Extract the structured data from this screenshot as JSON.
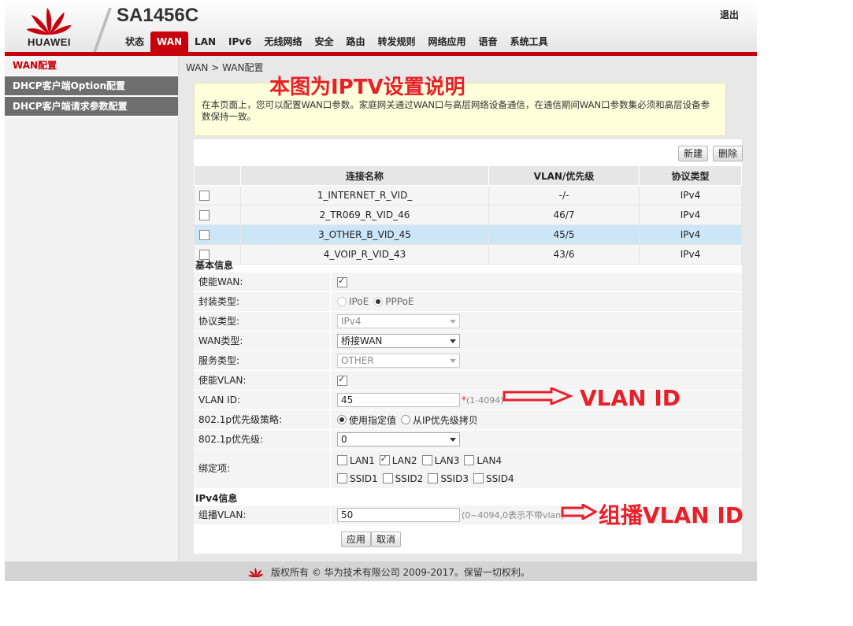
{
  "header": {
    "brand": "HUAWEI",
    "model": "SA1456C",
    "logout": "退出"
  },
  "nav": [
    "状态",
    "WAN",
    "LAN",
    "IPv6",
    "无线网络",
    "安全",
    "路由",
    "转发规则",
    "网络应用",
    "语音",
    "系统工具"
  ],
  "nav_active": "WAN",
  "sidebar": {
    "items": [
      "WAN配置",
      "DHCP客户端Option配置",
      "DHCP客户端请求参数配置"
    ]
  },
  "breadcrumb": "WAN > WAN配置",
  "iptv_note": "本图为IPTV设置说明",
  "notice": "在本页面上，您可以配置WAN口参数。家庭网关通过WAN口与高层网络设备通信，在通信期间WAN口参数集必须和高层设备参数保持一致。",
  "buttons": {
    "new": "新建",
    "delete": "删除",
    "apply": "应用",
    "cancel": "取消"
  },
  "table": {
    "headers": [
      "",
      "连接名称",
      "VLAN/优先级",
      "协议类型"
    ],
    "rows": [
      {
        "name": "1_INTERNET_R_VID_",
        "vlan": "-/-",
        "proto": "IPv4",
        "selected": false
      },
      {
        "name": "2_TR069_R_VID_46",
        "vlan": "46/7",
        "proto": "IPv4",
        "selected": false
      },
      {
        "name": "3_OTHER_B_VID_45",
        "vlan": "45/5",
        "proto": "IPv4",
        "selected": true
      },
      {
        "name": "4_VOIP_R_VID_43",
        "vlan": "43/6",
        "proto": "IPv4",
        "selected": false
      }
    ]
  },
  "basic": {
    "title": "基本信息",
    "enable_wan_label": "使能WAN:",
    "encap_label": "封装类型:",
    "encap_ipoe": "IPoE",
    "encap_pppoe": "PPPoE",
    "proto_label": "协议类型:",
    "proto_value": "IPv4",
    "wan_type_label": "WAN类型:",
    "wan_type_value": "桥接WAN",
    "service_label": "服务类型:",
    "service_value": "OTHER",
    "enable_vlan_label": "使能VLAN:",
    "vlan_id_label": "VLAN ID:",
    "vlan_id_value": "45",
    "vlan_id_hint_star": "*",
    "vlan_id_hint": "(1-4094)",
    "prio_policy_label": "802.1p优先级策略:",
    "prio_policy_specified": "使用指定值",
    "prio_policy_copy": "从IP优先级拷贝",
    "prio_label": "802.1p优先级:",
    "prio_value": "0",
    "bind_label": "绑定项:",
    "bind_lan": [
      "LAN1",
      "LAN2",
      "LAN3",
      "LAN4"
    ],
    "bind_ssid": [
      "SSID1",
      "SSID2",
      "SSID3",
      "SSID4"
    ]
  },
  "ipv4": {
    "title": "IPv4信息",
    "mcast_label": "组播VLAN:",
    "mcast_value": "50",
    "mcast_hint": "(0~4094,0表示不带vlan)"
  },
  "annotations": {
    "vlan_id": "VLAN ID",
    "mcast_vlan_id": "组播VLAN ID"
  },
  "footer": "版权所有 © 华为技术有限公司 2009-2017。保留一切权利。",
  "colors": {
    "brand_red": "#c7000b",
    "annotation_red": "#e8202a",
    "selected_row": "#cde6f7",
    "notice_bg": "#ffffdc"
  }
}
